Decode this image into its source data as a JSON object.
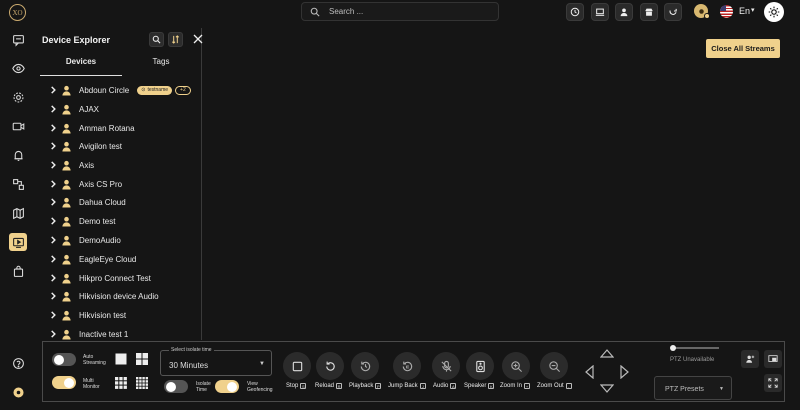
{
  "app": {
    "logo_text": "XO"
  },
  "search": {
    "placeholder": "Search ..."
  },
  "header": {
    "language": "En"
  },
  "panel": {
    "title": "Device Explorer",
    "tabs": [
      "Devices",
      "Tags"
    ],
    "devices": [
      {
        "name": "Abdoun Circle",
        "tag": "testname",
        "more": "+2"
      },
      {
        "name": "AJAX"
      },
      {
        "name": "Amman Rotana"
      },
      {
        "name": "Avigilon test"
      },
      {
        "name": "Axis"
      },
      {
        "name": "Axis CS Pro"
      },
      {
        "name": "Dahua Cloud"
      },
      {
        "name": "Demo test"
      },
      {
        "name": "DemoAudio"
      },
      {
        "name": "EagleEye Cloud"
      },
      {
        "name": "Hikpro Connect Test"
      },
      {
        "name": "Hikvision device Audio"
      },
      {
        "name": "Hikvision test"
      },
      {
        "name": "Inactive test 1"
      }
    ]
  },
  "main": {
    "close_all_label": "Close All Streams"
  },
  "bottom": {
    "auto_streaming": "Auto Streaming",
    "multi_monitor": "Multi Monitor",
    "isolate_time_caption": "Select isolate time",
    "isolate_time_value": "30 Minutes",
    "isolate_time_toggle": "Isolate Time",
    "view_geofencing": "View Geofencing",
    "controls": [
      {
        "label": "Stop",
        "key": "S"
      },
      {
        "label": "Reload",
        "key": "R"
      },
      {
        "label": "Playback",
        "key": "P"
      },
      {
        "label": "Jump Back",
        "key": "J"
      },
      {
        "label": "Audio",
        "key": "A"
      },
      {
        "label": "Speaker",
        "key": "K"
      },
      {
        "label": "Zoom In",
        "key": "+"
      },
      {
        "label": "Zoom Out",
        "key": "-"
      }
    ],
    "ptz_unavailable": "PTZ Unavailable",
    "ptz_presets": "PTZ Presets"
  },
  "colors": {
    "accent": "#f0d18c",
    "background": "#151515"
  }
}
